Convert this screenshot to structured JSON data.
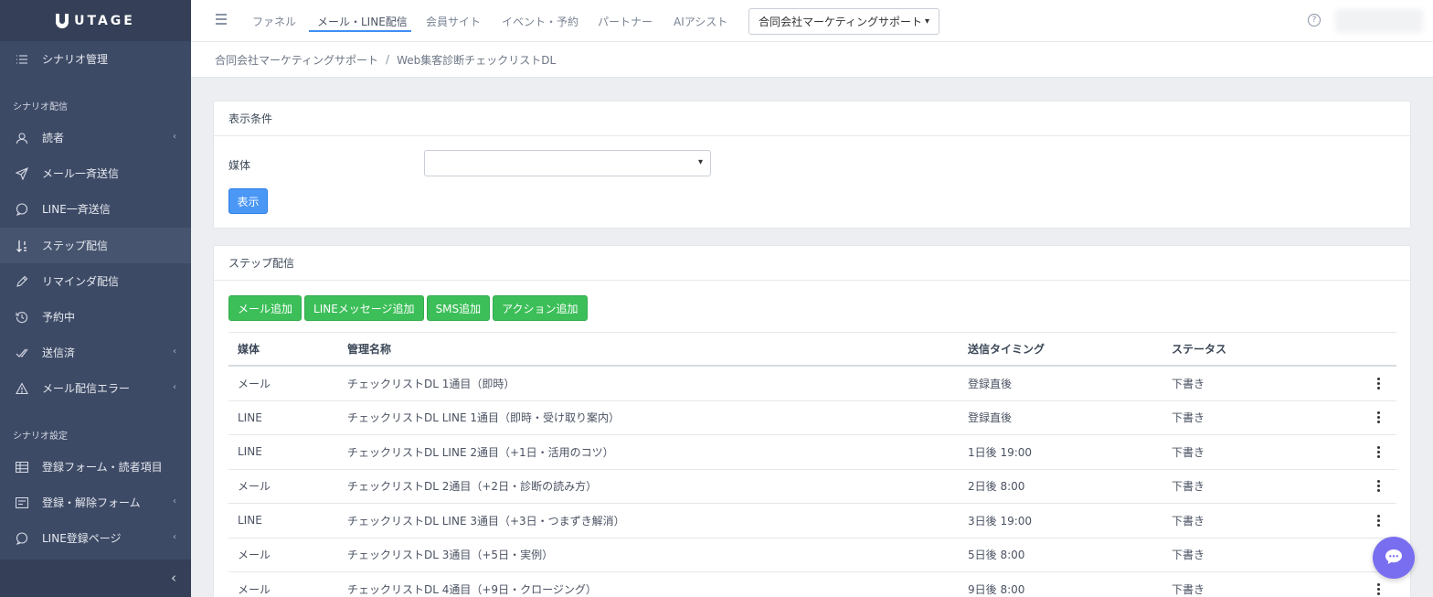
{
  "brand": {
    "name": "UTAGE"
  },
  "sidebar": {
    "top_item": {
      "label": "シナリオ管理",
      "icon": "list-icon"
    },
    "sections": [
      {
        "label": "シナリオ配信"
      },
      {
        "label": "シナリオ設定"
      }
    ],
    "items": [
      {
        "label": "読者",
        "icon": "user-icon",
        "has_submenu": true
      },
      {
        "label": "メール一斉送信",
        "icon": "paper-plane-icon",
        "has_submenu": false
      },
      {
        "label": "LINE一斉送信",
        "icon": "chat-bubble-icon",
        "has_submenu": false
      },
      {
        "label": "ステップ配信",
        "icon": "sort-icon",
        "has_submenu": false,
        "active": true
      },
      {
        "label": "リマインダ配信",
        "icon": "pencil-icon",
        "has_submenu": false
      },
      {
        "label": "予約中",
        "icon": "history-icon",
        "has_submenu": false
      },
      {
        "label": "送信済",
        "icon": "double-check-icon",
        "has_submenu": true
      },
      {
        "label": "メール配信エラー",
        "icon": "warning-icon",
        "has_submenu": true
      },
      {
        "label": "登録フォーム・読者項目",
        "icon": "table-icon",
        "has_submenu": false
      },
      {
        "label": "登録・解除フォーム",
        "icon": "form-icon",
        "has_submenu": true
      },
      {
        "label": "LINE登録ページ",
        "icon": "chat-bubble-icon",
        "has_submenu": true
      }
    ]
  },
  "topnav": {
    "items": [
      {
        "label": "ファネル"
      },
      {
        "label": "メール・LINE配信",
        "active": true
      },
      {
        "label": "会員サイト"
      },
      {
        "label": "イベント・予約"
      },
      {
        "label": "パートナー"
      },
      {
        "label": "AIアシスト"
      }
    ],
    "org_select": {
      "value": "合同会社マーケティングサポート"
    }
  },
  "breadcrumb": {
    "items": [
      "合同会社マーケティングサポート",
      "Web集客診断チェックリストDL"
    ],
    "separator": "/"
  },
  "filter": {
    "title": "表示条件",
    "media_label": "媒体",
    "media_value": "",
    "show_button": "表示"
  },
  "step": {
    "title": "ステップ配信",
    "buttons": [
      "メール追加",
      "LINEメッセージ追加",
      "SMS追加",
      "アクション追加"
    ],
    "columns": {
      "media": "媒体",
      "name": "管理名称",
      "timing": "送信タイミング",
      "status": "ステータス"
    },
    "rows": [
      {
        "media": "メール",
        "name": "チェックリストDL 1通目（即時）",
        "timing": "登録直後",
        "status": "下書き"
      },
      {
        "media": "LINE",
        "name": "チェックリストDL LINE 1通目（即時・受け取り案内）",
        "timing": "登録直後",
        "status": "下書き"
      },
      {
        "media": "LINE",
        "name": "チェックリストDL LINE 2通目（+1日・活用のコツ）",
        "timing": "1日後 19:00",
        "status": "下書き"
      },
      {
        "media": "メール",
        "name": "チェックリストDL 2通目（+2日・診断の読み方）",
        "timing": "2日後 8:00",
        "status": "下書き"
      },
      {
        "media": "LINE",
        "name": "チェックリストDL LINE 3通目（+3日・つまずき解消）",
        "timing": "3日後 19:00",
        "status": "下書き"
      },
      {
        "media": "メール",
        "name": "チェックリストDL 3通目（+5日・実例）",
        "timing": "5日後 8:00",
        "status": "下書き"
      },
      {
        "media": "メール",
        "name": "チェックリストDL 4通目（+9日・クロージング）",
        "timing": "9日後 8:00",
        "status": "下書き"
      }
    ]
  },
  "colors": {
    "sidebar_bg": "#3d4a66",
    "sidebar_active": "#46546f",
    "primary": "#4a97f5",
    "success": "#3cbf59",
    "chat": "#7a6ef0",
    "nav_active_underline": "#3e8ef7"
  }
}
